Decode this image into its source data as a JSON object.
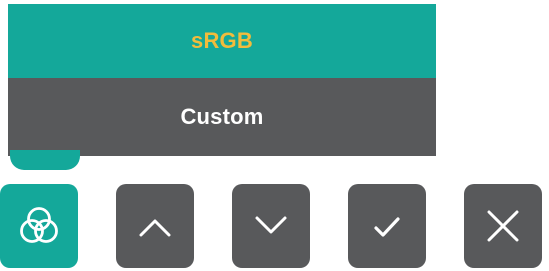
{
  "menu": {
    "items": [
      {
        "label": "sRGB",
        "selected": true
      },
      {
        "label": "Custom",
        "selected": false
      }
    ]
  },
  "buttons": [
    {
      "icon": "color-mode-icon",
      "action": "color-mode",
      "active": true
    },
    {
      "icon": "chevron-up-icon",
      "action": "up",
      "active": false
    },
    {
      "icon": "chevron-down-icon",
      "action": "down",
      "active": false
    },
    {
      "icon": "checkmark-icon",
      "action": "confirm",
      "active": false
    },
    {
      "icon": "close-icon",
      "action": "close",
      "active": false
    }
  ],
  "colors": {
    "accent": "#14a89a",
    "selected_text": "#f2bc3c",
    "panel": "#58595b",
    "text": "#ffffff"
  }
}
